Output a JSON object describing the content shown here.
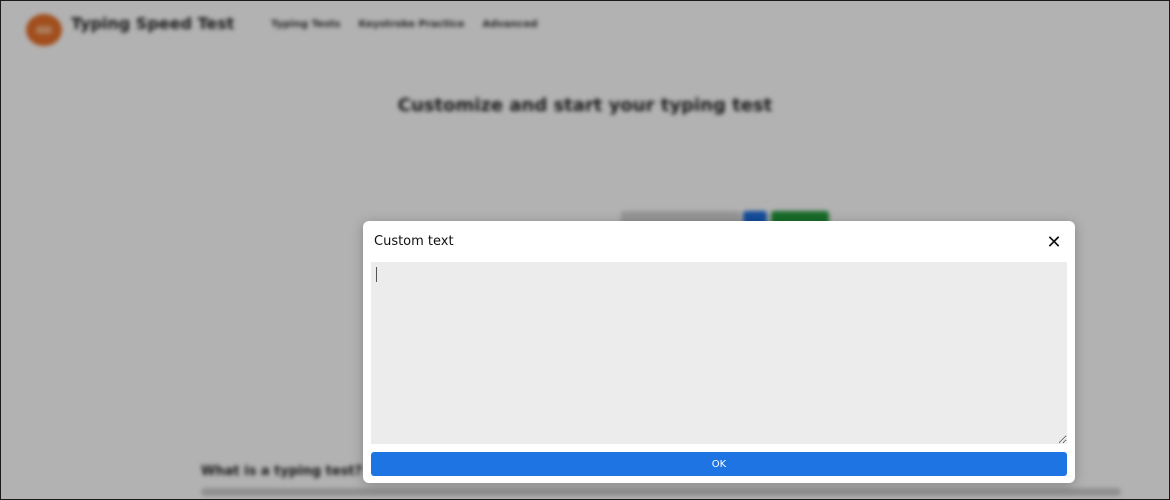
{
  "header": {
    "brand": "Typing Speed Test",
    "nav": [
      "Typing Tests",
      "Keystroke Practice",
      "Advanced"
    ]
  },
  "hero": {
    "title": "Customize and start your typing test"
  },
  "section": {
    "title": "What is a typing test?"
  },
  "modal": {
    "title": "Custom text",
    "text_value": "",
    "ok_label": "OK"
  },
  "colors": {
    "brand_orange": "#e8702a",
    "primary_blue": "#1f74e4",
    "green": "#239a3c",
    "textarea_bg": "#ececec"
  }
}
